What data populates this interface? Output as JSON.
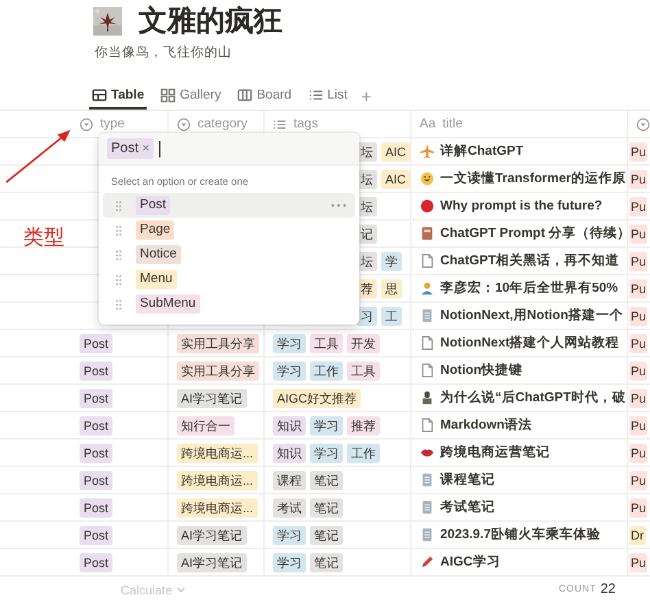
{
  "page": {
    "title": "文雅的疯狂",
    "subtitle": "你当像鸟，飞往你的山"
  },
  "views": [
    {
      "label": "Table",
      "selected": true
    },
    {
      "label": "Gallery",
      "selected": false
    },
    {
      "label": "Board",
      "selected": false
    },
    {
      "label": "List",
      "selected": false
    }
  ],
  "add_view": "+",
  "columns": [
    {
      "label": "type",
      "kind": "select"
    },
    {
      "label": "category",
      "kind": "select"
    },
    {
      "label": "tags",
      "kind": "multi"
    },
    {
      "label": "title",
      "kind": "text",
      "prefix": "Aa"
    },
    {
      "kind": "select"
    }
  ],
  "rows": [
    {
      "tags": [
        {
          "text": "坛",
          "color": "#e3e2e0"
        },
        {
          "text": "AIC",
          "color": "#fdecc8"
        }
      ],
      "title": "详解ChatGPT",
      "status": {
        "text": "Pu",
        "color": "#ffe2dd"
      }
    },
    {
      "tags": [
        {
          "text": "坛",
          "color": "#e3e2e0"
        },
        {
          "text": "AIC",
          "color": "#fdecc8"
        }
      ],
      "title": "一文读懂Transformer的运作原",
      "status": {
        "text": "Pu",
        "color": "#ffe2dd"
      }
    },
    {
      "tags": [
        {
          "text": "坛",
          "color": "#e3e2e0"
        }
      ],
      "title": "Why prompt is the future?",
      "status": {
        "text": "Pu",
        "color": "#ffe2dd"
      }
    },
    {
      "tags": [
        {
          "text": "记",
          "color": "#e3e2e0"
        }
      ],
      "title": "ChatGPT Prompt 分享（待续）",
      "status": {
        "text": "Pu",
        "color": "#ffe2dd"
      }
    },
    {
      "tags": [
        {
          "text": "坛",
          "color": "#e3e2e0"
        },
        {
          "text": "学",
          "color": "#d3e5ef"
        }
      ],
      "title": "ChatGPT相关黑话，再不知道",
      "status": {
        "text": "Pu",
        "color": "#ffe2dd"
      }
    },
    {
      "tags": [
        {
          "text": "荐",
          "color": "#fdecc8"
        },
        {
          "text": "思",
          "color": "#fdecc8"
        }
      ],
      "title": "李彦宏：10年后全世界有50%",
      "status": {
        "text": "Pu",
        "color": "#ffe2dd"
      }
    },
    {
      "tags": [
        {
          "text": "习",
          "color": "#d3e5ef"
        },
        {
          "text": "工",
          "color": "#d3e5ef"
        }
      ],
      "title": "NotionNext,用Notion搭建一个",
      "status": {
        "text": "Pu",
        "color": "#ffe2dd"
      }
    },
    {
      "type": {
        "text": "Post",
        "color": "#e8deee"
      },
      "category": {
        "text": "实用工具分享",
        "color": "#f4dfd8"
      },
      "tags": [
        {
          "text": "学习",
          "color": "#d3e5ef"
        },
        {
          "text": "工具",
          "color": "#f5e0e9"
        },
        {
          "text": "开发",
          "color": "#f5e0e9"
        }
      ],
      "title": "NotionNext搭建个人网站教程",
      "status": {
        "text": "Pu",
        "color": "#ffe2dd"
      }
    },
    {
      "type": {
        "text": "Post",
        "color": "#e8deee"
      },
      "category": {
        "text": "实用工具分享",
        "color": "#f4dfd8"
      },
      "tags": [
        {
          "text": "学习",
          "color": "#d3e5ef"
        },
        {
          "text": "工作",
          "color": "#d3e5ef"
        },
        {
          "text": "工具",
          "color": "#f5e0e9"
        }
      ],
      "title": "Notion快捷键",
      "status": {
        "text": "Pu",
        "color": "#ffe2dd"
      }
    },
    {
      "type": {
        "text": "Post",
        "color": "#e8deee"
      },
      "category": {
        "text": "AI学习笔记",
        "color": "#e3e2e0"
      },
      "tags": [
        {
          "text": "AIGC好文推荐",
          "color": "#fdecc8"
        }
      ],
      "title": "为什么说“后ChatGPT时代，破",
      "status": {
        "text": "Pu",
        "color": "#ffe2dd"
      }
    },
    {
      "type": {
        "text": "Post",
        "color": "#e8deee"
      },
      "category": {
        "text": "知行合一",
        "color": "#f5e0e9"
      },
      "tags": [
        {
          "text": "知识",
          "color": "#e8deee"
        },
        {
          "text": "学习",
          "color": "#d3e5ef"
        },
        {
          "text": "推荐",
          "color": "#f5e0e9"
        }
      ],
      "title": "Markdown语法",
      "status": {
        "text": "Pu",
        "color": "#ffe2dd"
      }
    },
    {
      "type": {
        "text": "Post",
        "color": "#e8deee"
      },
      "category": {
        "text": "跨境电商运...",
        "color": "#fdecc8"
      },
      "tags": [
        {
          "text": "知识",
          "color": "#e8deee"
        },
        {
          "text": "学习",
          "color": "#d3e5ef"
        },
        {
          "text": "工作",
          "color": "#d3e5ef"
        }
      ],
      "title": "跨境电商运营笔记",
      "status": {
        "text": "Pu",
        "color": "#ffe2dd"
      }
    },
    {
      "type": {
        "text": "Post",
        "color": "#e8deee"
      },
      "category": {
        "text": "跨境电商运...",
        "color": "#fdecc8"
      },
      "tags": [
        {
          "text": "课程",
          "color": "#e3e2e0"
        },
        {
          "text": "笔记",
          "color": "#e3e2e0"
        }
      ],
      "title": "课程笔记",
      "status": {
        "text": "Pu",
        "color": "#ffe2dd"
      }
    },
    {
      "type": {
        "text": "Post",
        "color": "#e8deee"
      },
      "category": {
        "text": "跨境电商运...",
        "color": "#fdecc8"
      },
      "tags": [
        {
          "text": "考试",
          "color": "#e3e2e0"
        },
        {
          "text": "笔记",
          "color": "#e3e2e0"
        }
      ],
      "title": "考试笔记",
      "status": {
        "text": "Pu",
        "color": "#ffe2dd"
      }
    },
    {
      "type": {
        "text": "Post",
        "color": "#e8deee"
      },
      "category": {
        "text": "AI学习笔记",
        "color": "#e3e2e0"
      },
      "tags": [
        {
          "text": "学习",
          "color": "#d3e5ef"
        },
        {
          "text": "笔记",
          "color": "#e3e2e0"
        }
      ],
      "title": "2023.9.7卧铺火车乘车体验",
      "status": {
        "text": "Dr",
        "color": "#fdecc8"
      }
    },
    {
      "type": {
        "text": "Post",
        "color": "#e8deee"
      },
      "category": {
        "text": "AI学习笔记",
        "color": "#e3e2e0"
      },
      "tags": [
        {
          "text": "学习",
          "color": "#d3e5ef"
        },
        {
          "text": "笔记",
          "color": "#e3e2e0"
        }
      ],
      "title": "AIGC学习",
      "status": {
        "text": "Pu",
        "color": "#ffe2dd"
      }
    }
  ],
  "footer": {
    "calculate": "Calculate",
    "count_label": "COUNT",
    "count": "22"
  },
  "popup": {
    "chip": {
      "text": "Post",
      "color": "#e8deee",
      "remove": "×"
    },
    "hint": "Select an option or create one",
    "options": [
      {
        "text": "Post",
        "color": "#e8deee",
        "selected": true
      },
      {
        "text": "Page",
        "color": "#fadec9",
        "selected": false
      },
      {
        "text": "Notice",
        "color": "#eee0da",
        "selected": false
      },
      {
        "text": "Menu",
        "color": "#fdecc8",
        "selected": false
      },
      {
        "text": "SubMenu",
        "color": "#f5e0e9",
        "selected": false
      }
    ]
  },
  "annotation": {
    "text": "类型"
  }
}
